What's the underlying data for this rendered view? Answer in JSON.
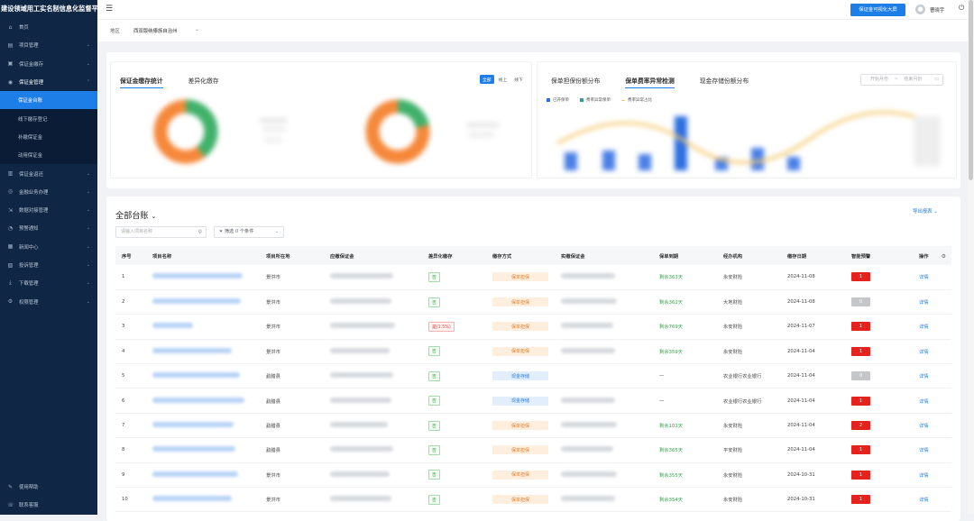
{
  "app": {
    "title": "建设领域用工实名制信息化监督平台"
  },
  "sidebar": {
    "items": [
      {
        "label": "首页",
        "icon": "home-icon",
        "glyph": "⌂",
        "chevron": ""
      },
      {
        "label": "项目管理",
        "icon": "project-icon",
        "glyph": "▤",
        "chevron": "⌄"
      },
      {
        "label": "保证金缴存",
        "icon": "deposit-icon",
        "glyph": "▣",
        "chevron": "⌄"
      },
      {
        "label": "保证金管理",
        "icon": "manage-icon",
        "glyph": "◉",
        "chevron": "⌃"
      }
    ],
    "sub_items": [
      {
        "label": "保证金台账"
      },
      {
        "label": "线下缴存登记"
      },
      {
        "label": "补缴保证金"
      },
      {
        "label": "动用保证金"
      }
    ],
    "items_after": [
      {
        "label": "保证金返还",
        "icon": "refund-icon",
        "glyph": "▥",
        "chevron": "⌄"
      },
      {
        "label": "金融业务办理",
        "icon": "finance-icon",
        "glyph": "◎",
        "chevron": "⌄"
      },
      {
        "label": "数据对接管理",
        "icon": "data-link-icon",
        "glyph": "⇲",
        "chevron": "⌄"
      },
      {
        "label": "预警通知",
        "icon": "bell-icon",
        "glyph": "◔",
        "chevron": "⌄"
      },
      {
        "label": "新闻中心",
        "icon": "news-icon",
        "glyph": "▦",
        "chevron": "⌄"
      },
      {
        "label": "投诉管理",
        "icon": "complaint-icon",
        "glyph": "▧",
        "chevron": "⌄"
      },
      {
        "label": "下载管理",
        "icon": "download-icon",
        "glyph": "⤓",
        "chevron": "⌄"
      },
      {
        "label": "权限管理",
        "icon": "permission-icon",
        "glyph": "⚙",
        "chevron": "⌄"
      }
    ],
    "bottom": [
      {
        "label": "使用帮助",
        "icon": "help-icon",
        "glyph": "✎"
      },
      {
        "label": "联系客服",
        "icon": "service-icon",
        "glyph": "☏"
      }
    ]
  },
  "topbar": {
    "screen_button": "保证金可视化大屏",
    "username": "曹晓宇"
  },
  "region": {
    "label": "地区",
    "value": "西双版纳傣族自治州"
  },
  "stats": {
    "left_tabs": [
      "保证金缴存统计",
      "差异化缴存"
    ],
    "segments": [
      "全部",
      "线上",
      "线下"
    ],
    "right_tabs": [
      "保单担保份额分布",
      "保单费率异常检测",
      "现金存储份额分布"
    ],
    "date_start": "开始月份",
    "date_sep": "~",
    "date_end": "结束月份",
    "legend": [
      "已开保单",
      "费率异常保单",
      "费率异常占比"
    ],
    "colors": {
      "orange": "#f5883a",
      "green": "#3fb16a",
      "blue": "#2e6fe0",
      "line": "#f4c86a"
    }
  },
  "ledger": {
    "title": "全部台账",
    "export": "导出报表",
    "search_placeholder": "请输入项目名称",
    "filter_prefix": "筛选",
    "filter_count": "0",
    "filter_suffix": "个条件",
    "columns": [
      "序号",
      "项目名称",
      "项目所在地",
      "应缴保证金",
      "差异化缴存",
      "缴存方式",
      "实缴保证金",
      "保单到期",
      "经办机构",
      "缴存日期",
      "智能预警",
      "操作"
    ],
    "rows": [
      {
        "no": "1",
        "location": "景洪市",
        "diff": "否",
        "diff_color": "green",
        "method": "保单担保",
        "method_color": "orange",
        "expiry": "剩余363天",
        "agency": "永安财险",
        "date": "2024-11-08",
        "alert": "1",
        "alert_color": "red",
        "op": "详情"
      },
      {
        "no": "2",
        "location": "景洪市",
        "diff": "否",
        "diff_color": "green",
        "method": "保单担保",
        "method_color": "orange",
        "expiry": "剩余362天",
        "agency": "大地财险",
        "date": "2024-11-08",
        "alert": "0",
        "alert_color": "grey",
        "op": "详情"
      },
      {
        "no": "3",
        "location": "景洪市",
        "diff": "是(1.5%)",
        "diff_color": "red",
        "method": "保单担保",
        "method_color": "orange",
        "expiry": "剩余769天",
        "agency": "永安财险",
        "date": "2024-11-07",
        "alert": "1",
        "alert_color": "red",
        "op": "详情"
      },
      {
        "no": "4",
        "location": "景洪市",
        "diff": "否",
        "diff_color": "green",
        "method": "保单担保",
        "method_color": "orange",
        "expiry": "剩余359天",
        "agency": "永安财险",
        "date": "2024-11-04",
        "alert": "1",
        "alert_color": "red",
        "op": "详情"
      },
      {
        "no": "5",
        "location": "勐腊县",
        "diff": "否",
        "diff_color": "green",
        "method": "现金存储",
        "method_color": "blue",
        "expiry": "—",
        "agency": "农业银行农业银行",
        "date": "2024-11-04",
        "alert": "0",
        "alert_color": "grey",
        "op": "详情"
      },
      {
        "no": "6",
        "location": "勐腊县",
        "diff": "否",
        "diff_color": "green",
        "method": "现金存储",
        "method_color": "blue",
        "expiry": "—",
        "agency": "农业银行农业银行",
        "date": "2024-11-04",
        "alert": "1",
        "alert_color": "red",
        "op": "详情"
      },
      {
        "no": "7",
        "location": "勐腊县",
        "diff": "否",
        "diff_color": "green",
        "method": "保单担保",
        "method_color": "orange",
        "expiry": "剩余102天",
        "agency": "永安财险",
        "date": "2024-11-04",
        "alert": "2",
        "alert_color": "red",
        "op": "详情"
      },
      {
        "no": "8",
        "location": "勐腊县",
        "diff": "否",
        "diff_color": "green",
        "method": "保单担保",
        "method_color": "orange",
        "expiry": "剩余365天",
        "agency": "平安财险",
        "date": "2024-11-04",
        "alert": "1",
        "alert_color": "red",
        "op": "详情"
      },
      {
        "no": "9",
        "location": "景洪市",
        "diff": "否",
        "diff_color": "green",
        "method": "保单担保",
        "method_color": "orange",
        "expiry": "剩余355天",
        "agency": "永安财险",
        "date": "2024-10-31",
        "alert": "1",
        "alert_color": "red",
        "op": "详情"
      },
      {
        "no": "10",
        "location": "景洪市",
        "diff": "否",
        "diff_color": "green",
        "method": "保单担保",
        "method_color": "orange",
        "expiry": "剩余354天",
        "agency": "永安财险",
        "date": "2024-10-31",
        "alert": "1",
        "alert_color": "red",
        "op": "详情"
      }
    ]
  }
}
